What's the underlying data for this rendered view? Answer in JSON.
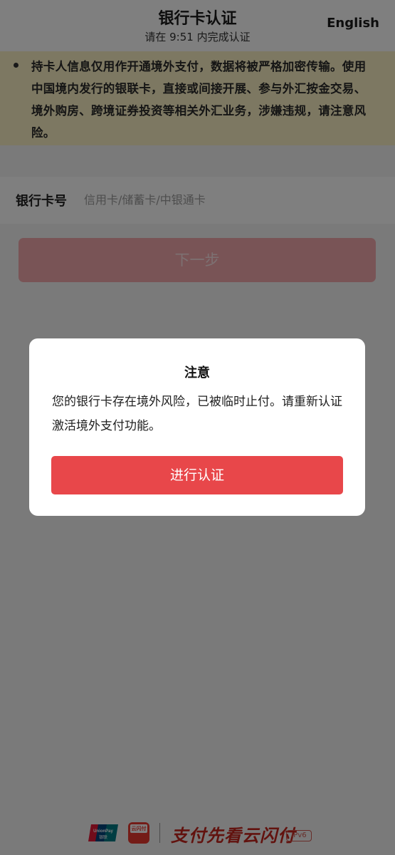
{
  "header": {
    "title": "银行卡认证",
    "subtitle": "请在 9:51 内完成认证",
    "language_link": "English"
  },
  "notice": {
    "text": "持卡人信息仅用作开通境外支付，数据将被严格加密传输。使用中国境内发行的银联卡，直接或间接开展、参与外汇按金交易、境外购房、跨境证券投资等相关外汇业务，涉嫌违规，请注意风险。"
  },
  "form": {
    "card_label": "银行卡号",
    "card_placeholder": "信用卡/储蓄卡/中银通卡",
    "card_value": "",
    "next_label": "下一步"
  },
  "dialog": {
    "title": "注意",
    "message": "您的银行卡存在境外风险，已被临时止付。请重新认证激活境外支付功能。",
    "confirm_label": "进行认证"
  },
  "footer": {
    "unionpay_top": "UnionPay",
    "unionpay_bottom": "银联",
    "cloudpay": "云闪付",
    "slogan": "支付先看云闪付",
    "badge": "IPv6"
  },
  "colors": {
    "accent_red": "#e8474a",
    "notice_bg": "#fbf1c4",
    "overlay": "rgba(0,0,0,0.5)"
  },
  "icons": [
    "unionpay-logo-icon",
    "cloudpay-logo-icon",
    "bullet-icon"
  ]
}
